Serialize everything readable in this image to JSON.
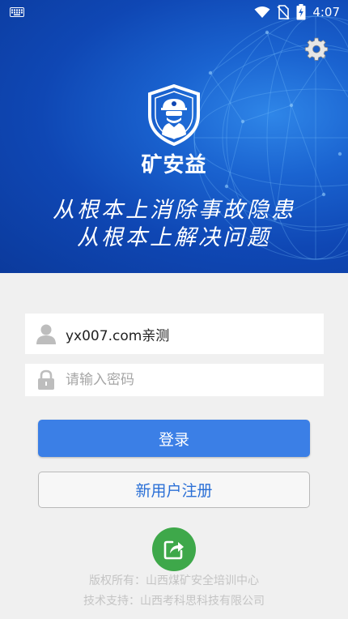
{
  "status_bar": {
    "time": "4:07",
    "icons": [
      "keyboard-icon",
      "wifi-icon",
      "no-sim-icon",
      "battery-charging-icon"
    ]
  },
  "header": {
    "app_name": "矿安益",
    "slogan_line1": "从根本上消除事故隐患",
    "slogan_line2": "从根本上解决问题",
    "settings_icon": "gear-icon",
    "logo_icon": "miner-shield-logo-icon"
  },
  "login_form": {
    "username_value": "yx007.com亲测",
    "password_placeholder": "请输入密码",
    "login_label": "登录",
    "register_label": "新用户注册"
  },
  "share": {
    "icon": "share-icon",
    "color": "#3ea84a"
  },
  "footer": {
    "copyright": "版权所有：山西煤矿安全培训中心",
    "tech_support": "技术支持：山西考科思科技有限公司"
  },
  "colors": {
    "header_blue": "#1a63d0",
    "primary_button": "#3b7fe6",
    "register_text": "#2a6fd6",
    "background": "#f0f0f0"
  }
}
